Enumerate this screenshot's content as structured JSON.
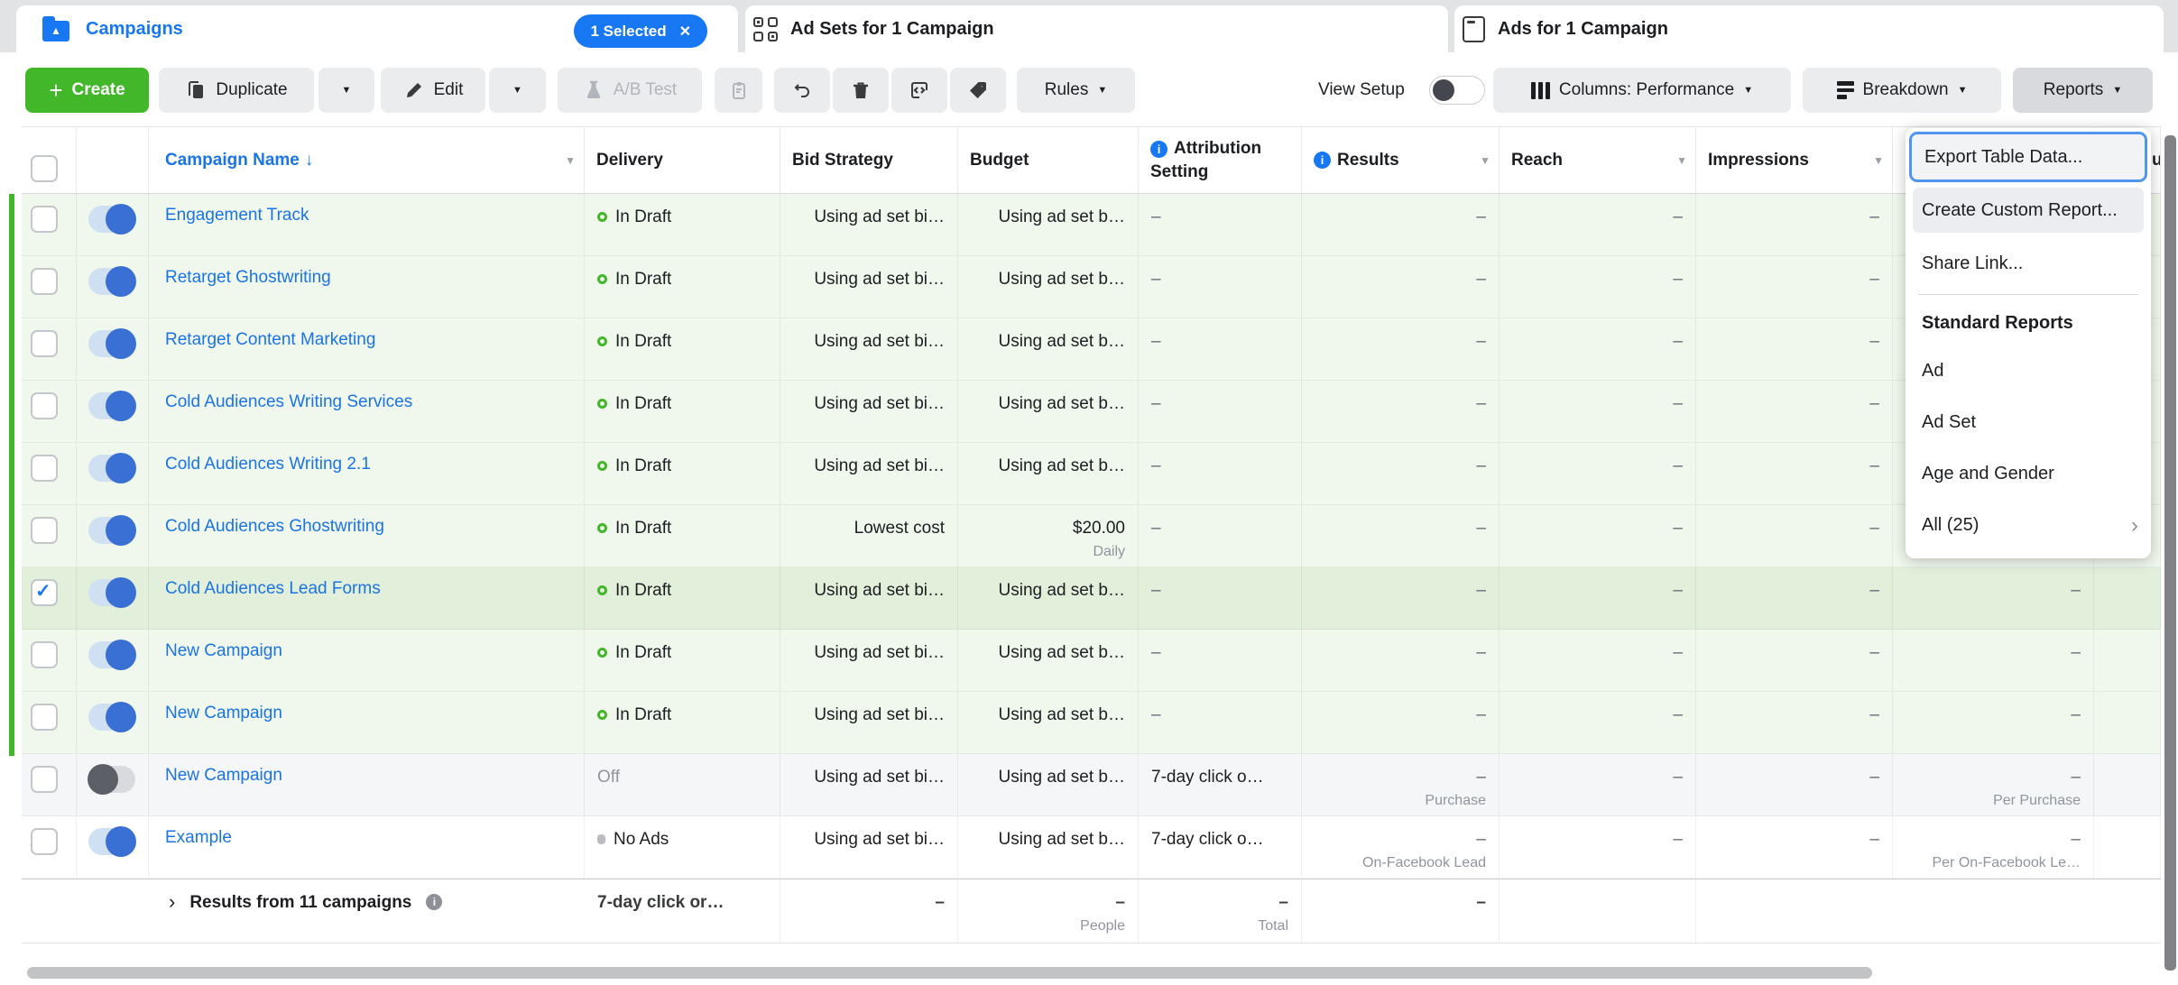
{
  "colors": {
    "accent_blue": "#1877f2",
    "brand_green": "#42b72a",
    "row_green": "#f0f7ec",
    "row_green_selected": "#e2efda"
  },
  "tabs": {
    "campaigns": {
      "label": "Campaigns",
      "selected_badge": "1 Selected"
    },
    "ad_sets": {
      "label": "Ad Sets for 1 Campaign"
    },
    "ads": {
      "label": "Ads for 1 Campaign"
    }
  },
  "toolbar": {
    "create_label": "Create",
    "duplicate_label": "Duplicate",
    "edit_label": "Edit",
    "ab_test_label": "A/B Test",
    "rules_label": "Rules",
    "view_setup_label": "View Setup",
    "columns_label": "Columns: Performance",
    "breakdown_label": "Breakdown",
    "reports_label": "Reports"
  },
  "reports_menu": {
    "export_item": "Export Table Data...",
    "create_custom_item": "Create Custom Report...",
    "share_item": "Share Link...",
    "section_title": "Standard Reports",
    "items": {
      "ad": "Ad",
      "ad_set": "Ad Set",
      "age_gender": "Age and Gender",
      "all": "All (25)"
    }
  },
  "table": {
    "columns": {
      "name": "Campaign Name",
      "name_sort": "↓",
      "delivery": "Delivery",
      "bid_strategy": "Bid Strategy",
      "budget": "Budget",
      "attribution": "Attribution Setting",
      "results": "Results",
      "reach": "Reach",
      "impressions": "Impressions",
      "partial_fragment": "u"
    },
    "rows": [
      {
        "name": "Engagement Track",
        "delivery": "In Draft",
        "bid": "Using ad set bi…",
        "budget": "Using ad set b…",
        "attribution": "–",
        "results": "–",
        "reach": "–",
        "impressions": "–",
        "cost": "–"
      },
      {
        "name": "Retarget Ghostwriting",
        "delivery": "In Draft",
        "bid": "Using ad set bi…",
        "budget": "Using ad set b…",
        "attribution": "–",
        "results": "–",
        "reach": "–",
        "impressions": "–",
        "cost": "–"
      },
      {
        "name": "Retarget Content Marketing",
        "delivery": "In Draft",
        "bid": "Using ad set bi…",
        "budget": "Using ad set b…",
        "attribution": "–",
        "results": "–",
        "reach": "–",
        "impressions": "–",
        "cost": "–"
      },
      {
        "name": "Cold Audiences Writing Services",
        "delivery": "In Draft",
        "bid": "Using ad set bi…",
        "budget": "Using ad set b…",
        "attribution": "–",
        "results": "–",
        "reach": "–",
        "impressions": "–",
        "cost": "–"
      },
      {
        "name": "Cold Audiences Writing 2.1",
        "delivery": "In Draft",
        "bid": "Using ad set bi…",
        "budget": "Using ad set b…",
        "attribution": "–",
        "results": "–",
        "reach": "–",
        "impressions": "–",
        "cost": "–"
      },
      {
        "name": "Cold Audiences Ghostwriting",
        "delivery": "In Draft",
        "bid": "Lowest cost",
        "budget": "$20.00",
        "budget_sub": "Daily",
        "attribution": "–",
        "results": "–",
        "reach": "–",
        "impressions": "–",
        "cost": "–"
      },
      {
        "name": "Cold Audiences Lead Forms",
        "delivery": "In Draft",
        "bid": "Using ad set bi…",
        "budget": "Using ad set b…",
        "attribution": "–",
        "results": "–",
        "reach": "–",
        "impressions": "–",
        "cost": "–"
      },
      {
        "name": "New Campaign",
        "delivery": "In Draft",
        "bid": "Using ad set bi…",
        "budget": "Using ad set b…",
        "attribution": "–",
        "results": "–",
        "reach": "–",
        "impressions": "–",
        "cost": "–"
      },
      {
        "name": "New Campaign",
        "delivery": "In Draft",
        "bid": "Using ad set bi…",
        "budget": "Using ad set b…",
        "attribution": "–",
        "results": "–",
        "reach": "–",
        "impressions": "–",
        "cost": "–"
      },
      {
        "name": "New Campaign",
        "delivery": "Off",
        "bid": "Using ad set bi…",
        "budget": "Using ad set b…",
        "attribution": "7-day click o…",
        "results": "–",
        "results_sub": "Purchase",
        "reach": "–",
        "impressions": "–",
        "cost": "–",
        "cost_sub": "Per Purchase"
      },
      {
        "name": "Example",
        "delivery": "No Ads",
        "bid": "Using ad set bi…",
        "budget": "Using ad set b…",
        "attribution": "7-day click o…",
        "results": "–",
        "results_sub": "On-Facebook Lead",
        "reach": "–",
        "impressions": "–",
        "cost": "–",
        "cost_sub": "Per On-Facebook Le…"
      }
    ],
    "summary": {
      "label": "Results from 11 campaigns",
      "attribution": "7-day click or…",
      "results": "–",
      "reach": "–",
      "reach_sub": "People",
      "impressions": "–",
      "impressions_sub": "Total",
      "cost": "–"
    }
  }
}
